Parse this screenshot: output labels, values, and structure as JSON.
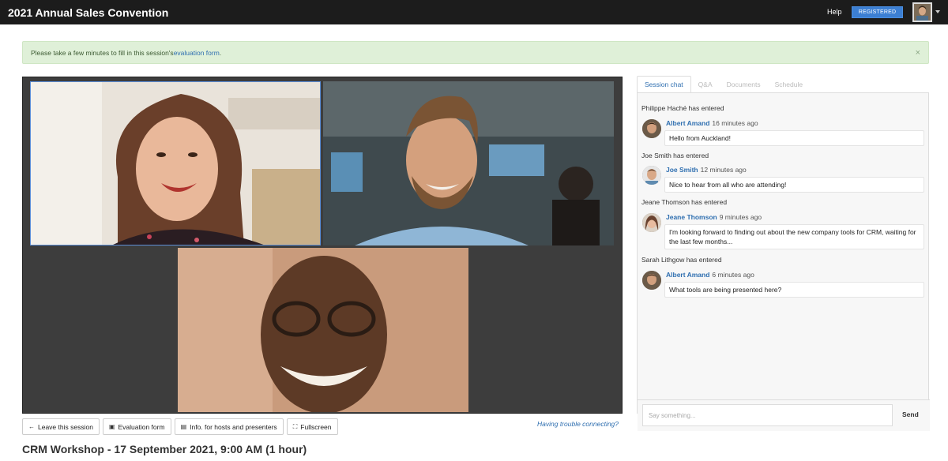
{
  "topbar": {
    "title": "2021 Annual Sales Convention",
    "help": "Help",
    "registered": "REGISTERED"
  },
  "notice": {
    "text": "Please take a few minutes to fill in this session's ",
    "link": "evaluation form",
    "suffix": ".",
    "close": "×"
  },
  "controls": {
    "leave": "Leave this session",
    "evaluation": "Evaluation form",
    "info": "Info. for hosts and presenters",
    "fullscreen": "Fullscreen",
    "trouble": "Having trouble connecting?"
  },
  "session_title": "CRM Workshop - 17 September 2021, 9:00 AM (1 hour)",
  "chat": {
    "tabs": [
      "Session chat",
      "Q&A",
      "Documents",
      "Schedule"
    ],
    "active_tab": "Session chat",
    "entries": [
      {
        "type": "system",
        "text": "Philippe Haché has entered"
      },
      {
        "type": "message",
        "name": "Albert Amand",
        "time": "16 minutes ago",
        "text": "Hello from Auckland!"
      },
      {
        "type": "system",
        "text": "Joe Smith has entered"
      },
      {
        "type": "message",
        "name": "Joe Smith",
        "time": "12 minutes ago",
        "text": "Nice to hear from all who are attending!"
      },
      {
        "type": "system",
        "text": "Jeane Thomson has entered"
      },
      {
        "type": "message",
        "name": "Jeane Thomson",
        "time": "9 minutes ago",
        "text": "I'm looking forward to finding out about the new company tools for CRM, waiting for the last few months..."
      },
      {
        "type": "system",
        "text": "Sarah Lithgow has entered"
      },
      {
        "type": "message",
        "name": "Albert Amand",
        "time": "6 minutes ago",
        "text": "What tools are being presented here?"
      }
    ],
    "input_placeholder": "Say something...",
    "send": "Send"
  },
  "colors": {
    "accent": "#2f6fb0",
    "topbar": "#1c1c1c",
    "notice_bg": "#dff0d8",
    "registered": "#3c7fd3"
  }
}
